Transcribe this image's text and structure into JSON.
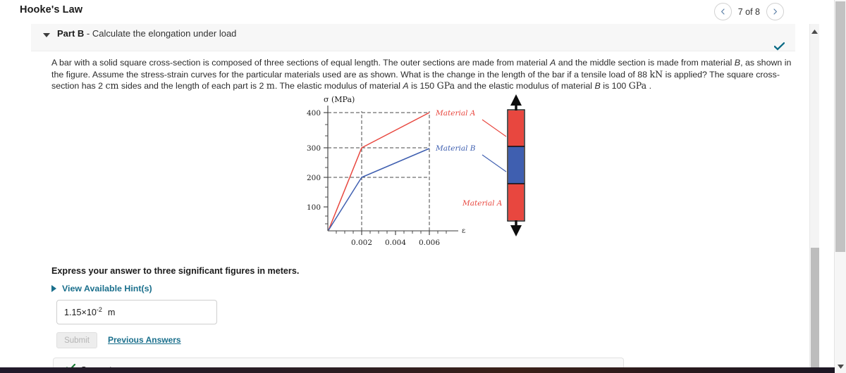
{
  "header": {
    "app_title": "Hooke's Law",
    "pager": {
      "prev_icon": "chevron-left-icon",
      "next_icon": "chevron-right-icon",
      "label": "7 of 8"
    }
  },
  "part": {
    "caret_icon": "chevron-down-icon",
    "name": "Part B",
    "dash": " - ",
    "description": "Calculate the elongation under load",
    "status_icon": "check-icon"
  },
  "statement": {
    "line1_a": "A bar with a solid square cross-section is composed of three sections of equal length. The outer sections are made from material ",
    "mat_a_1": "A",
    "line1_b": " and the middle section is made from material ",
    "mat_b_1": "B",
    "line1_c": ", as shown in the figure. Assume the stress-strain curves for the particular materials used are as shown. What is the change in the length of the bar if a tensile load of 88 ",
    "unit_kn": "kN",
    "line2_a": " is applied? The square cross-section has 2 ",
    "unit_cm": "cm",
    "line2_b": " sides and the length of each part is 2 ",
    "unit_m": "m",
    "line2_c": ". The elastic modulus of material ",
    "mat_a_2": "A",
    "line2_d": " is 150 ",
    "unit_gpa_1": "GPa",
    "line2_e": " and the elastic modulus of material ",
    "mat_b_2": "B",
    "line2_f": " is 100 ",
    "unit_gpa_2": "GPa",
    "line2_g": " ."
  },
  "chart_data": {
    "type": "line",
    "title": "",
    "xlabel": "ε",
    "ylabel": "σ  (MPa)",
    "xlim": [
      0,
      0.0072
    ],
    "ylim": [
      0,
      430
    ],
    "grid": "dashed-guides",
    "x_ticks": [
      0.002,
      0.004,
      0.006
    ],
    "x_tick_labels": [
      "0.002",
      "0.004",
      "0.006"
    ],
    "y_ticks": [
      100,
      200,
      300,
      400
    ],
    "y_tick_labels": [
      "100",
      "200",
      "300",
      "400"
    ],
    "guide_lines_y": [
      200,
      300,
      400
    ],
    "guide_lines_x": [
      0.002,
      0.006
    ],
    "series": [
      {
        "name": "Material A",
        "color": "#e8473f",
        "x": [
          0,
          0.002,
          0.006
        ],
        "values": [
          0,
          300,
          400
        ]
      },
      {
        "name": "Material B",
        "color": "#3f5fb0",
        "x": [
          0,
          0.002,
          0.006
        ],
        "values": [
          0,
          200,
          300
        ]
      }
    ],
    "annotations": [
      {
        "text": "Material A",
        "color": "#e8473f"
      },
      {
        "text": "Material B",
        "color": "#3f5fb0"
      },
      {
        "text": "Material A",
        "color": "#e8473f"
      }
    ]
  },
  "figure": {
    "axis_y_label": "σ  (MPa)",
    "axis_x_label": "ε",
    "y_labels": [
      "400",
      "300",
      "200",
      "100"
    ],
    "x_labels": [
      "0.002",
      "0.004",
      "0.006"
    ],
    "legend_a": "Material A",
    "legend_b": "Material B",
    "bar_label": "Material A",
    "colors": {
      "material_a": "#e8473f",
      "material_b": "#3f5fb0"
    }
  },
  "answer": {
    "express_text": "Express your answer to three significant figures in meters.",
    "hints_label": "View Available Hint(s)",
    "hints_caret_icon": "triangle-right-icon",
    "value_mantissa": "1.15×10",
    "value_exponent": "-2",
    "unit": "m",
    "submit_label": "Submit",
    "previous_answers_label": "Previous Answers"
  },
  "feedback": {
    "check_icon": "check-icon",
    "label": "Correct"
  },
  "scrollbars": {
    "outer_down_icon": "triangle-down-icon",
    "inner_up_icon": "triangle-up-icon"
  },
  "colors": {
    "accent_link": "#1a6f8c",
    "material_a": "#e8473f",
    "material_b": "#3f5fb0",
    "correct_green": "#1a7a35",
    "status_check": "#0b6b86"
  }
}
